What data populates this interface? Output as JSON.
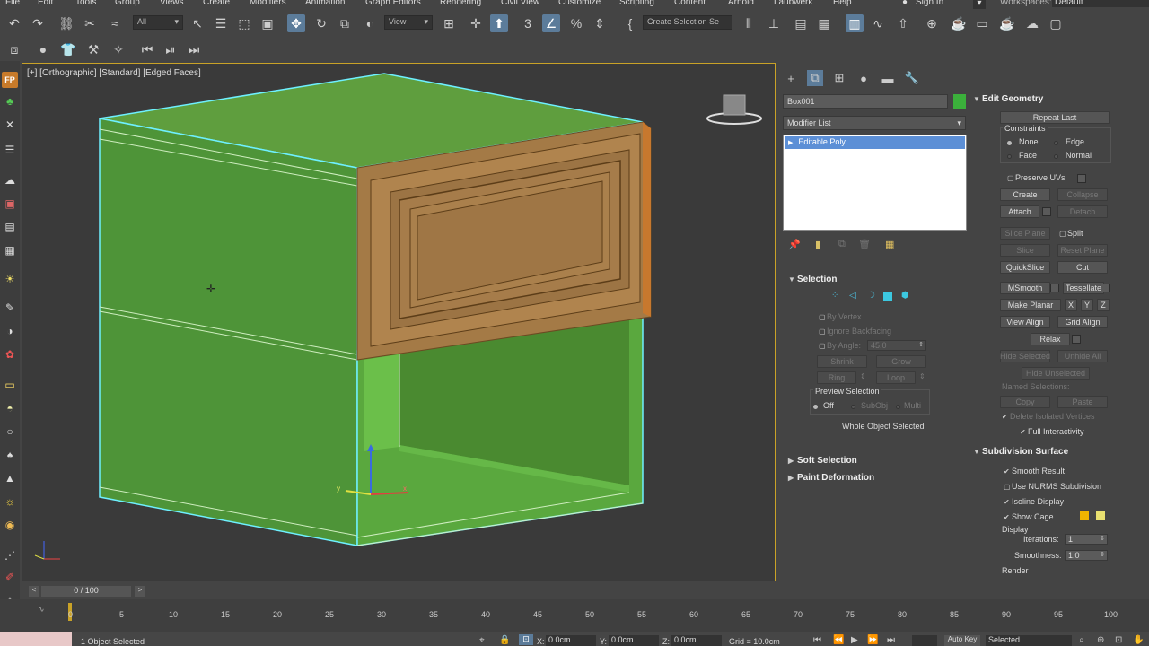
{
  "menu": [
    "File",
    "Edit",
    "Tools",
    "Group",
    "Views",
    "Create",
    "Modifiers",
    "Animation",
    "Graph Editors",
    "Rendering",
    "Civil View",
    "Customize",
    "Scripting",
    "Content",
    "Arnold",
    "Laubwerk",
    "Help"
  ],
  "signin": "Sign In",
  "workspaces_label": "Workspaces:",
  "workspaces_value": "Default",
  "toolbar": {
    "filter_value": "All",
    "refcoord_value": "View",
    "named_selection": "Create Selection Se"
  },
  "viewport": {
    "label": "[+] [Orthographic] [Standard] [Edged Faces]"
  },
  "command_panel": {
    "object_name": "Box001",
    "object_color": "#3bb03b",
    "modifier_list": "Modifier List",
    "stack_item": "Editable Poly",
    "selection": {
      "title": "Selection",
      "by_vertex": "By Vertex",
      "ignore_backfacing": "Ignore Backfacing",
      "by_angle": "By Angle:",
      "by_angle_value": "45.0",
      "shrink": "Shrink",
      "grow": "Grow",
      "ring": "Ring",
      "loop": "Loop",
      "preview_selection": "Preview Selection",
      "off": "Off",
      "subobj": "SubObj",
      "multi": "Multi",
      "status": "Whole Object Selected"
    },
    "soft_selection": "Soft Selection",
    "paint_deformation": "Paint Deformation",
    "edit_geometry": {
      "title": "Edit Geometry",
      "repeat_last": "Repeat Last",
      "constraints": "Constraints",
      "none": "None",
      "edge": "Edge",
      "face": "Face",
      "normal": "Normal",
      "preserve_uvs": "Preserve UVs",
      "create": "Create",
      "collapse": "Collapse",
      "attach": "Attach",
      "detach": "Detach",
      "slice_plane": "Slice Plane",
      "split": "Split",
      "slice": "Slice",
      "reset_plane": "Reset Plane",
      "quickslice": "QuickSlice",
      "cut": "Cut",
      "msmooth": "MSmooth",
      "tessellate": "Tessellate",
      "make_planar": "Make Planar",
      "x": "X",
      "y": "Y",
      "z": "Z",
      "view_align": "View Align",
      "grid_align": "Grid Align",
      "relax": "Relax",
      "hide_selected": "Hide Selected",
      "unhide_all": "Unhide All",
      "hide_unselected": "Hide Unselected",
      "named_selections": "Named Selections:",
      "copy": "Copy",
      "paste": "Paste",
      "delete_isolated": "Delete Isolated Vertices",
      "full_interactivity": "Full Interactivity"
    },
    "subdivision": {
      "title": "Subdivision Surface",
      "smooth_result": "Smooth Result",
      "use_nurms": "Use NURMS Subdivision",
      "isoline_display": "Isoline Display",
      "show_cage": "Show Cage......",
      "cage_color_1": "#f0b400",
      "cage_color_2": "#e8e070",
      "display": "Display",
      "iterations_label": "Iterations:",
      "iterations_value": "1",
      "smoothness_label": "Smoothness:",
      "smoothness_value": "1.0",
      "render": "Render"
    }
  },
  "timeline": {
    "frame": "0 / 100",
    "ticks": [
      "0",
      "5",
      "10",
      "15",
      "20",
      "25",
      "30",
      "35",
      "40",
      "45",
      "50",
      "55",
      "60",
      "65",
      "70",
      "75",
      "80",
      "85",
      "90",
      "95",
      "100"
    ]
  },
  "status": {
    "selection": "1 Object Selected",
    "x_label": "X:",
    "x_value": "0.0cm",
    "y_label": "Y:",
    "y_value": "0.0cm",
    "z_label": "Z:",
    "z_value": "0.0cm",
    "grid": "Grid = 10.0cm",
    "auto_key": "Auto Key",
    "selected": "Selected"
  }
}
